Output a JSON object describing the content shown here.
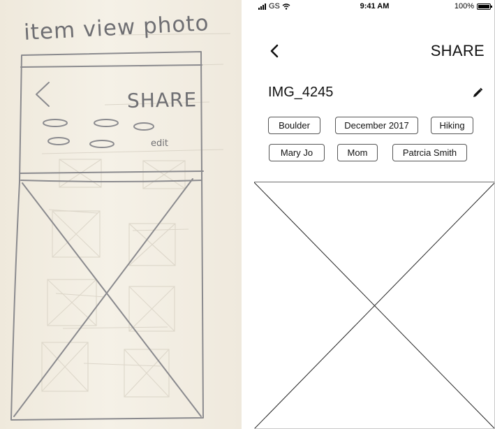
{
  "sketch": {
    "title": "item view photo",
    "share_label": "SHARE",
    "edit_label": "edit"
  },
  "status_bar": {
    "carrier": "GS",
    "time": "9:41 AM",
    "battery": "100%"
  },
  "nav": {
    "back_icon": "chevron-left-icon",
    "share_label": "SHARE"
  },
  "photo": {
    "title": "IMG_4245",
    "edit_icon": "pencil-icon"
  },
  "tags": [
    {
      "label": "Boulder"
    },
    {
      "label": "December 2017"
    },
    {
      "label": "Hiking"
    },
    {
      "label": "Mary Jo"
    },
    {
      "label": "Mom"
    },
    {
      "label": "Patrcia Smith"
    }
  ],
  "colors": {
    "paper": "#f3efe4",
    "pencil": "#7a7a7e",
    "wireframe_line": "#222222",
    "tag_border": "#555555"
  }
}
